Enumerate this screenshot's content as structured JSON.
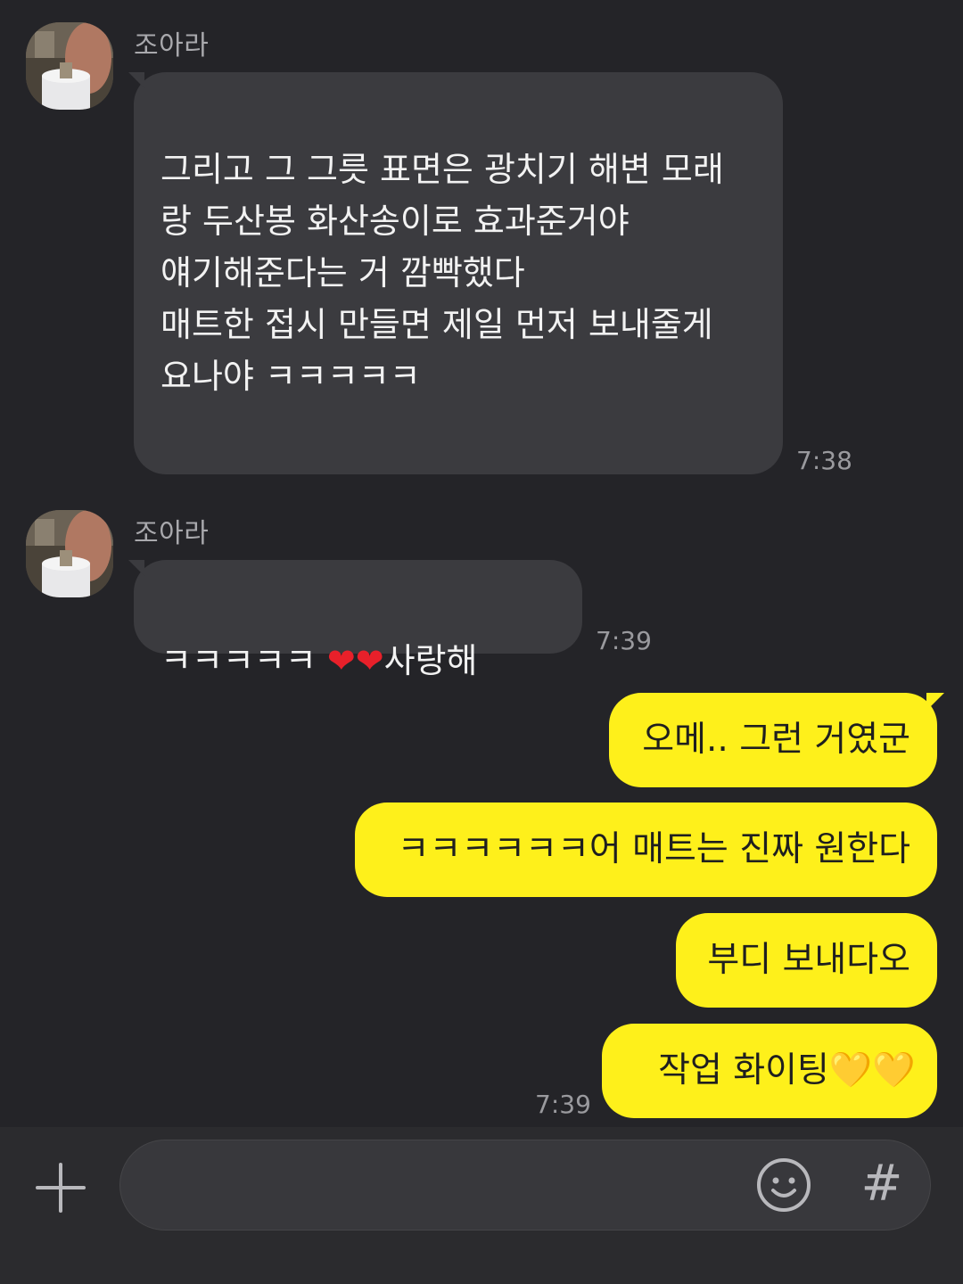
{
  "messages": [
    {
      "sender": "조아라",
      "text": "그리고 그 그릇 표면은 광치기 해변 모래\n랑 두산봉 화산송이로 효과준거야\n얘기해준다는 거 깜빡했다\n매트한 접시 만들면 제일 먼저 보내줄게\n요나야 ㅋㅋㅋㅋㅋ",
      "time": "7:38"
    },
    {
      "sender": "조아라",
      "text_prefix": "ㅋㅋㅋㅋㅋ ",
      "hearts": "❤❤",
      "text_suffix": "사랑해",
      "time": "7:39"
    }
  ],
  "my_messages": [
    {
      "text": "오메.. 그런 거였군"
    },
    {
      "text": "ㅋㅋㅋㅋㅋㅋ어 매트는 진짜 원한다"
    },
    {
      "text": "부디 보내다오"
    },
    {
      "text": "작업 화이팅",
      "hearts": "💛💛"
    }
  ],
  "my_time": "7:39",
  "input_bar": {
    "placeholder": "",
    "hash_label": "#"
  },
  "colors": {
    "background": "#242428",
    "their_bubble": "#3b3b3f",
    "my_bubble": "#fef01b",
    "heart_red": "#e8202a",
    "heart_yellow": "#f7c628"
  }
}
